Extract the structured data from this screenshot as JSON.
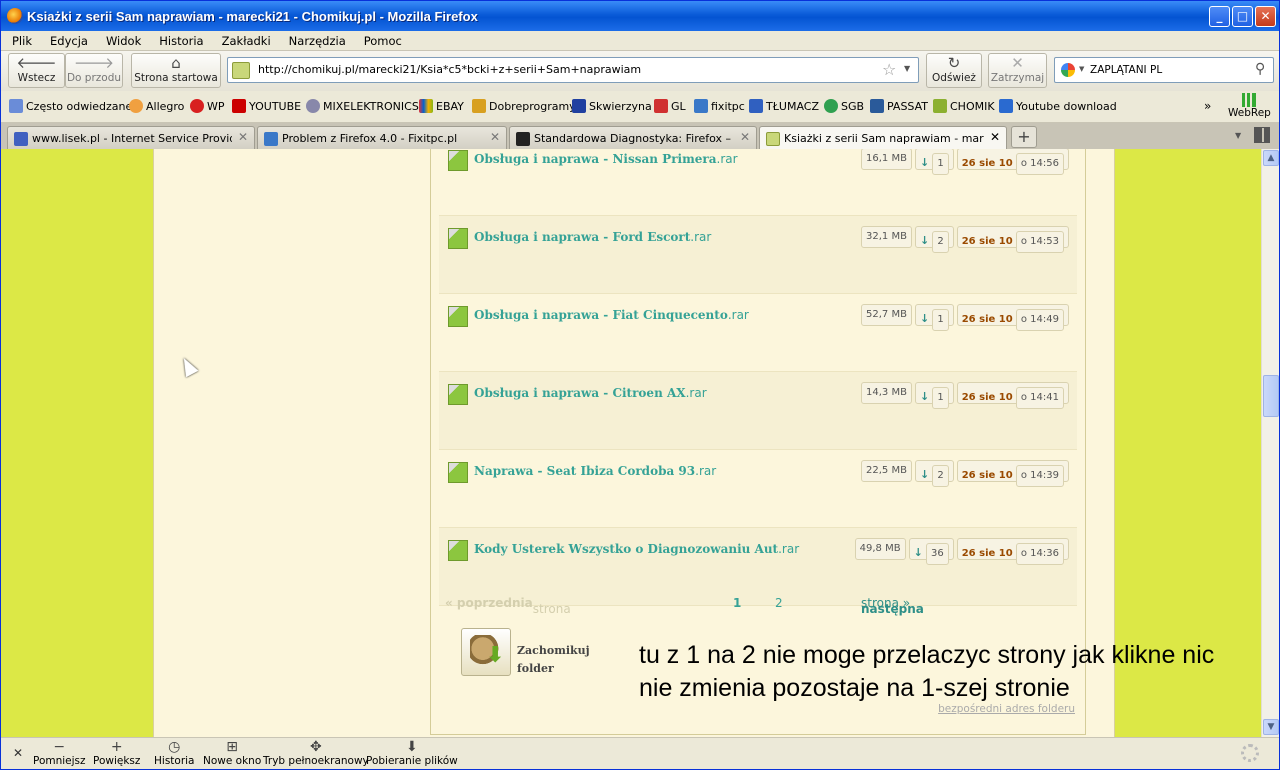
{
  "window": {
    "title": "Ksiażki z serii Sam naprawiam - marecki21 - Chomikuj.pl - Mozilla Firefox"
  },
  "menu": [
    "Plik",
    "Edycja",
    "Widok",
    "Historia",
    "Zakładki",
    "Narzędzia",
    "Pomoc"
  ],
  "nav": {
    "back": "Wstecz",
    "forward": "Do przodu",
    "home": "Strona startowa",
    "url": "http://chomikuj.pl/marecki21/Ksia*c5*bcki+z+serii+Sam+naprawiam",
    "reload": "Odśwież",
    "stop": "Zatrzymaj",
    "search_value": "ZAPLĄTANI PL"
  },
  "bookmarks": [
    "Często odwiedzane",
    "Allegro",
    "WP",
    "YOUTUBE",
    "MIXELEKTRONICS",
    "EBAY",
    "Dobreprogramy",
    "Skwierzyna",
    "GL",
    "fixitpc",
    "TŁUMACZ",
    "SGB",
    "PASSAT",
    "CHOMIK",
    "Youtube download"
  ],
  "webrep": "WebRep",
  "tabs": [
    {
      "label": "www.lisek.pl - Internet Service Provider -..."
    },
    {
      "label": "Problem z Firefox 4.0 - Fixitpc.pl"
    },
    {
      "label": "Standardowa Diagnostyka: Firefox – Moz..."
    },
    {
      "label": "Ksiażki z serii Sam naprawiam - marecki21..."
    }
  ],
  "files": [
    {
      "name": "Obsługa i naprawa - Nissan Primera",
      "ext": ".rar",
      "size": "16,1 MB",
      "downloads": "1",
      "date": "26 sie 10",
      "time": "o 14:56"
    },
    {
      "name": "Obsługa i naprawa - Ford Escort",
      "ext": ".rar",
      "size": "32,1 MB",
      "downloads": "2",
      "date": "26 sie 10",
      "time": "o 14:53"
    },
    {
      "name": "Obsługa i naprawa - Fiat Cinquecento",
      "ext": ".rar",
      "size": "52,7 MB",
      "downloads": "1",
      "date": "26 sie 10",
      "time": "o 14:49"
    },
    {
      "name": "Obsługa i naprawa - Citroen AX",
      "ext": ".rar",
      "size": "14,3 MB",
      "downloads": "1",
      "date": "26 sie 10",
      "time": "o 14:41"
    },
    {
      "name": "Naprawa - Seat Ibiza Cordoba 93",
      "ext": ".rar",
      "size": "22,5 MB",
      "downloads": "2",
      "date": "26 sie 10",
      "time": "o 14:39"
    },
    {
      "name": "Kody Usterek Wszystko o Diagnozowaniu Aut",
      "ext": ".rar",
      "size": "49,8 MB",
      "downloads": "36",
      "date": "26 sie 10",
      "time": "o 14:36"
    }
  ],
  "pager": {
    "prev_bold": "« poprzednia",
    "prev_rest": "strona",
    "page1": "1",
    "page2": "2",
    "next_bold": "następna",
    "next_rest": "strona »"
  },
  "zachomikuj": {
    "line1": "Zachomikuj",
    "line2": "folder"
  },
  "direct_link": "bezpośredni adres folderu",
  "annotation": {
    "line1": "tu z 1 na 2 nie moge przelaczyc strony jak klikne nic",
    "line2": "nie zmienia pozostaje na 1-szej stronie"
  },
  "bottom": [
    "Pomniejsz",
    "Powiększ",
    "Historia",
    "Nowe okno",
    "Tryb pełnoekranowy",
    "Pobieranie plików"
  ],
  "colors": {
    "page_bg": "#dce846",
    "content_bg": "#fcf6dc",
    "link": "#35a296",
    "date": "#9a4a00"
  }
}
